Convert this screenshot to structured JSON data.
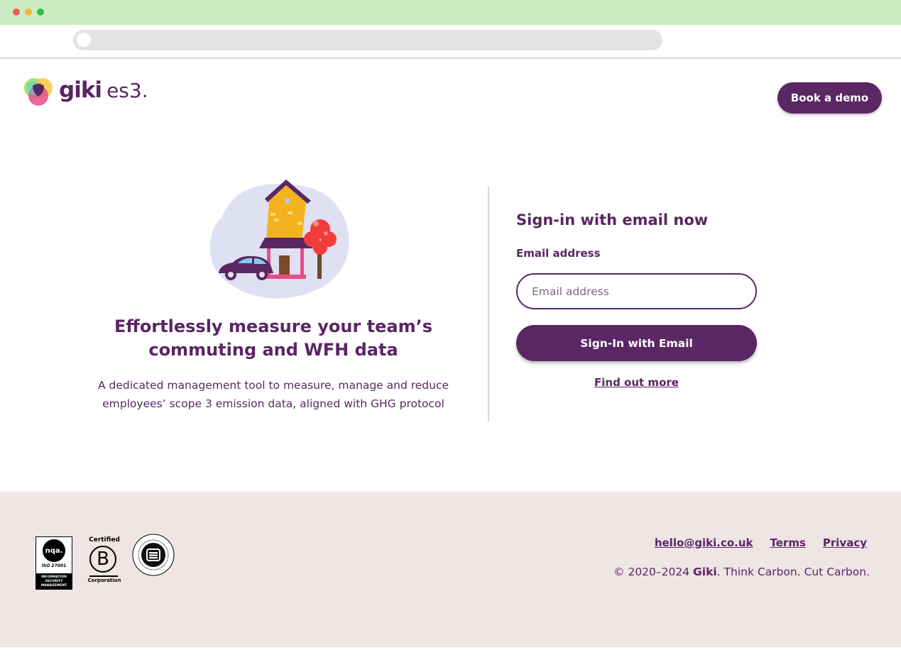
{
  "header": {
    "logo_word": "giki",
    "logo_sub": "es3.",
    "book_demo_label": "Book a demo"
  },
  "promo": {
    "title": "Effortlessly measure your team’s commuting and WFH data",
    "description": "A dedicated management tool to measure, manage and reduce employees’ scope 3 emission data, aligned with GHG protocol"
  },
  "signin": {
    "title": "Sign-in with email now",
    "email_label": "Email address",
    "email_placeholder": "Email address",
    "email_value": "",
    "submit_label": "Sign-In with Email",
    "find_out_more_label": "Find out more"
  },
  "footer": {
    "badges": {
      "nqa_logo": "nqa.",
      "nqa_iso": "ISO 27001",
      "nqa_caption": "INFORMATION SECURITY MANAGEMENT",
      "bcorp_certified": "Certified",
      "bcorp_letter": "B",
      "bcorp_corporation": "Corporation"
    },
    "links": [
      "hello@giki.co.uk",
      "Terms",
      "Privacy"
    ],
    "copyright_prefix": "© 2020–2024 ",
    "copyright_brand": "Giki",
    "copyright_suffix": ". Think Carbon. Cut Carbon."
  },
  "colors": {
    "brand_purple": "#5a2663",
    "footer_bg": "#efe5e5",
    "titlebar_bg": "#cbebc3"
  }
}
